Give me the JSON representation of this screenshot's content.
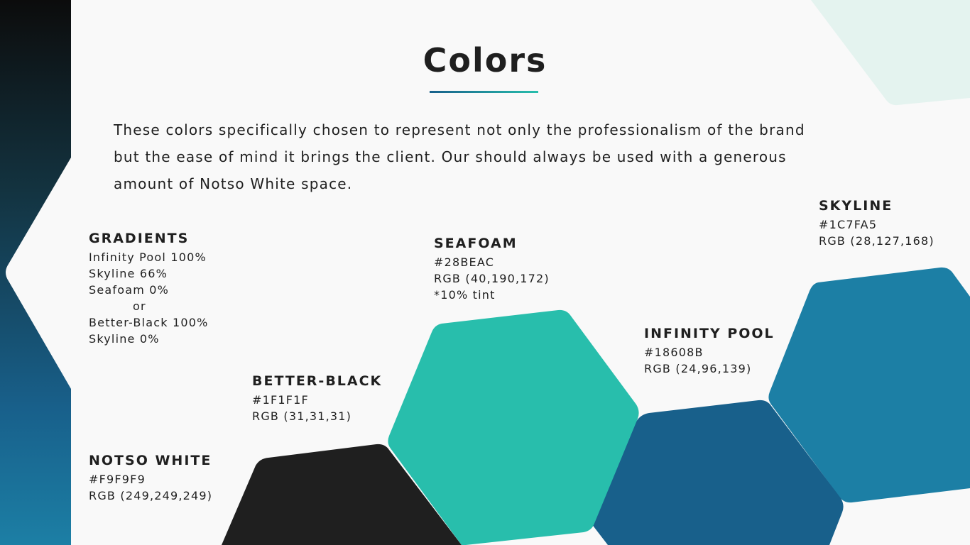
{
  "title": "Colors",
  "intro": "These colors specifically chosen to represent not only the professionalism of the brand but the ease of mind it brings the client. Our should always be used with a generous amount of Notso White space.",
  "gradients": {
    "name": "GRADIENTS",
    "lines": [
      "Infinity Pool 100%",
      "Skyline 66%",
      "Seafoam 0%",
      "or",
      "Better-Black 100%",
      "Skyline 0%"
    ]
  },
  "colors": {
    "notso_white": {
      "name": "NOTSO WHITE",
      "hex": "#F9F9F9",
      "rgb": "RGB (249,249,249)"
    },
    "better_black": {
      "name": "BETTER-BLACK",
      "hex": "#1F1F1F",
      "rgb": "RGB (31,31,31)"
    },
    "seafoam": {
      "name": "SEAFOAM",
      "hex": "#28BEAC",
      "rgb": "RGB (40,190,172)",
      "note": "*10% tint"
    },
    "infinity_pool": {
      "name": "INFINITY POOL",
      "hex": "#18608B",
      "rgb": "RGB (24,96,139)"
    },
    "skyline": {
      "name": "SKYLINE",
      "hex": "#1C7FA5",
      "rgb": "RGB (28,127,168)"
    }
  },
  "swatch_colors": {
    "better_black": "#1f1f1f",
    "seafoam": "#28beac",
    "infinity_pool": "#18608b",
    "skyline": "#1c7fa5",
    "seafoam_tint": "#e4f3ef"
  }
}
